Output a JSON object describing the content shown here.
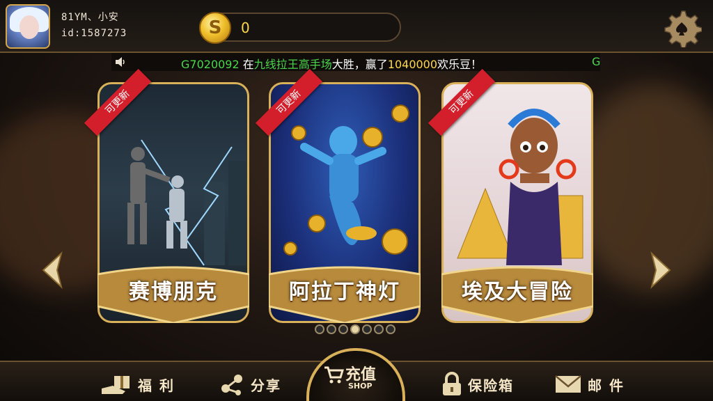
{
  "user": {
    "name": "81YM、小安",
    "id": "id:1587273"
  },
  "coins": {
    "symbol": "S",
    "value": "0"
  },
  "marquee": {
    "player": "G7020092",
    "text_1": " 在",
    "venue": "九线拉王高手场",
    "text_2": "大胜，赢了",
    "amount": "1040000",
    "text_3": "欢乐豆！",
    "trail": "G"
  },
  "games": [
    {
      "title": "赛博朋克",
      "badge": "可更新"
    },
    {
      "title": "阿拉丁神灯",
      "badge": "可更新"
    },
    {
      "title": "埃及大冒险",
      "badge": "可更新"
    }
  ],
  "pager": {
    "count": 7,
    "active": 4
  },
  "bottom_nav": {
    "welfare": "福 利",
    "share": "分享",
    "recharge": "充值",
    "shop": "SHOP",
    "safe": "保险箱",
    "mail": "邮 件"
  },
  "colors": {
    "gold": "#d9b15a",
    "badge_red": "#d31f2c",
    "marquee_green": "#4cd64c",
    "marquee_yellow": "#ffd84a"
  }
}
